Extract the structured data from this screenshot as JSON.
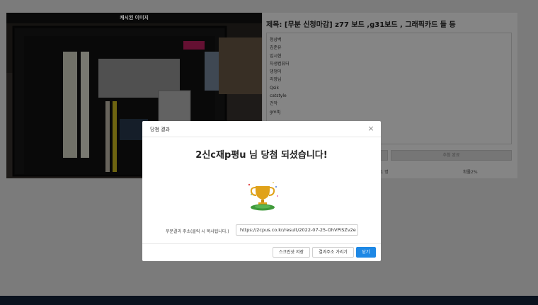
{
  "background": {
    "image_caption": "캐시된 이미지",
    "title": "제목: [무분 신청마감] z77 보드 ,g31보드 , 그래픽카드 들 등",
    "participants": [
      "청상벽",
      "김준유",
      "임시현",
      "차생컴퓨터",
      "댕댕이",
      "리장님",
      "Qsik",
      "catstyle",
      "건악",
      "gmltj"
    ],
    "apply_done_label": "추첨 완료",
    "winners_count": "당첨자1 명",
    "probability": "확률2%"
  },
  "modal": {
    "title": "당첨 결과",
    "close_glyph": "×",
    "winner_message": "2신c재p평u 님 당첨 되셨습니다!",
    "address_label": "무분결과 주소(클릭 시 복사됩니다.)",
    "address_value": "https://2cpus.co.kr/result/2022-07-25-OhVPISZv2e",
    "buttons": {
      "screenshot": "스크린샷 저장",
      "goto_result": "결과주소 가리기",
      "close": "닫기"
    }
  },
  "colors": {
    "primary": "#1e88e5",
    "footer": "#15233a",
    "trophy_gold": "#e0a21a",
    "trophy_base": "#3f9a3a"
  }
}
